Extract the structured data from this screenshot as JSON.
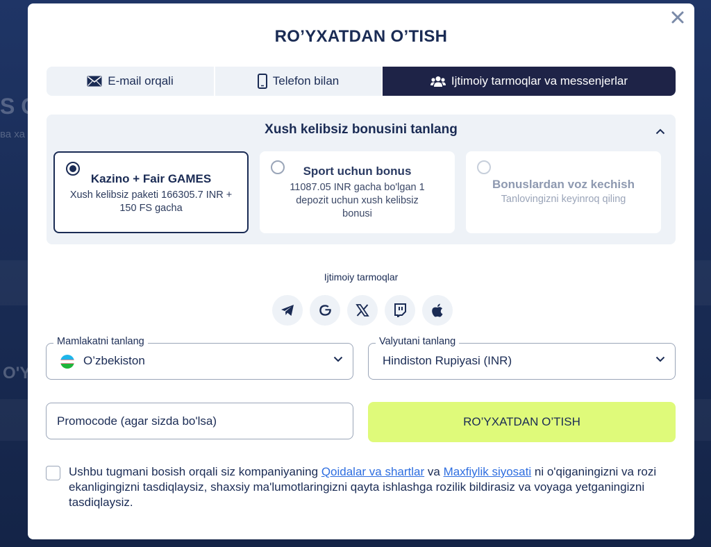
{
  "background": {
    "text_1": "S C",
    "text_2": "ва ха",
    "text_3": "O'Y"
  },
  "modal": {
    "title": "RO’YXATDAN O’TISH",
    "close_icon": "close-icon"
  },
  "tabs": [
    {
      "label": "E-mail orqali",
      "icon": "envelope-icon"
    },
    {
      "label": "Telefon bilan",
      "icon": "phone-icon"
    },
    {
      "label": "Ijtimoiy tarmoqlar va messenjerlar",
      "icon": "users-icon",
      "active": true
    }
  ],
  "bonus": {
    "title": "Xush kelibsiz bonusini tanlang",
    "cards": [
      {
        "title": "Kazino + Fair GAMES",
        "desc": "Xush kelibsiz paketi 166305.7 INR + 150 FS gacha",
        "selected": true
      },
      {
        "title": "Sport uchun bonus",
        "desc": "11087.05 INR gacha bo'lgan 1 depozit uchun xush kelibsiz bonusi",
        "selected": false
      },
      {
        "title": "Bonuslardan voz kechish",
        "desc": "Tanlovingizni keyinroq qiling",
        "selected": false
      }
    ]
  },
  "social": {
    "label": "Ijtimoiy tarmoqlar",
    "icons": [
      "telegram-icon",
      "google-icon",
      "x-icon",
      "twitch-icon",
      "apple-icon"
    ]
  },
  "country": {
    "label": "Mamlakatni tanlang",
    "value": "O’zbekiston"
  },
  "currency": {
    "label": "Valyutani tanlang",
    "value": "Hindiston Rupiyasi (INR)"
  },
  "promo": {
    "placeholder": "Promocode (agar sizda bo'lsa)"
  },
  "submit": {
    "label": "RO’YXATDAN O’TISH"
  },
  "consent": {
    "text_before": "Ushbu tugmani bosish orqali siz kompaniyaning ",
    "link_terms": "Qoidalar va shartlar",
    "text_mid": " va ",
    "link_privacy": "Maxfiylik siyosati",
    "text_after": " ni o'qiganingizni va rozi ekanligingizni tasdiqlaysiz, shaxsiy ma'lumotlaringizni qayta ishlashga rozilik bildirasiz va voyaga yetganingizni tasdiqlaysiz."
  },
  "colors": {
    "primary": "#1a2b54",
    "active_tab": "#1e2347",
    "submit_bg": "#dffa7a",
    "link": "#2e6ee0"
  }
}
